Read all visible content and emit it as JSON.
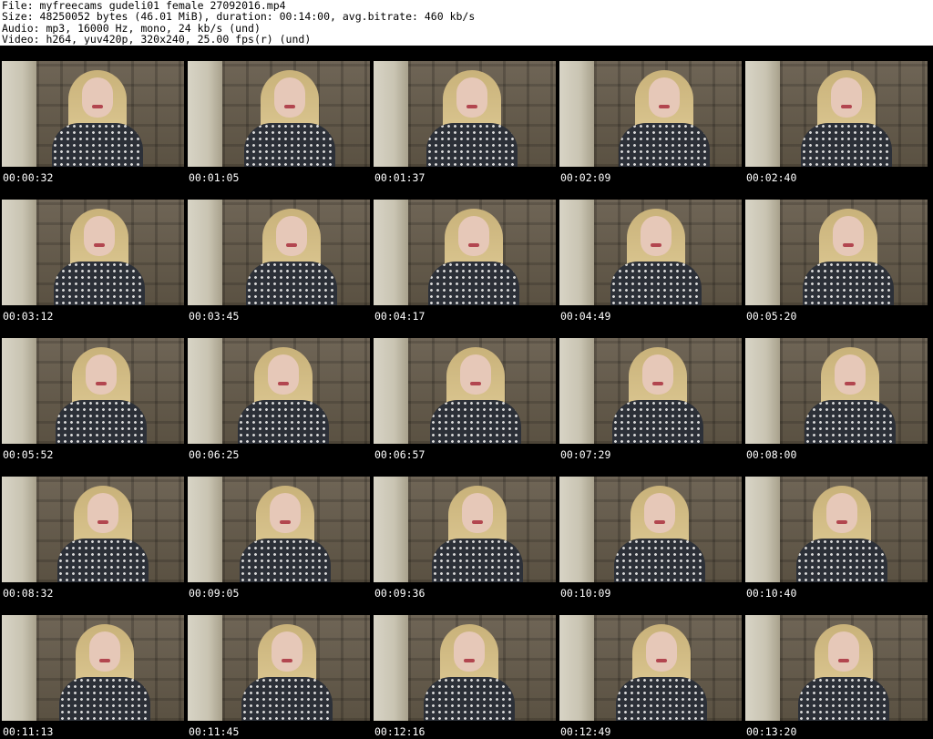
{
  "header": {
    "file_line": "File: myfreecams_gudeli01_female_27092016.mp4",
    "size_line": "Size: 48250052 bytes (46.01 MiB), duration: 00:14:00, avg.bitrate: 460 kb/s",
    "audio_line": "Audio: mp3, 16000 Hz, mono, 24 kb/s (und)",
    "video_line": "Video: h264, yuv420p, 320x240, 25.00 fps(r) (und)"
  },
  "thumbnails": [
    {
      "time": "00:00:32"
    },
    {
      "time": "00:01:05"
    },
    {
      "time": "00:01:37"
    },
    {
      "time": "00:02:09"
    },
    {
      "time": "00:02:40"
    },
    {
      "time": "00:03:12"
    },
    {
      "time": "00:03:45"
    },
    {
      "time": "00:04:17"
    },
    {
      "time": "00:04:49"
    },
    {
      "time": "00:05:20"
    },
    {
      "time": "00:05:52"
    },
    {
      "time": "00:06:25"
    },
    {
      "time": "00:06:57"
    },
    {
      "time": "00:07:29"
    },
    {
      "time": "00:08:00"
    },
    {
      "time": "00:08:32"
    },
    {
      "time": "00:09:05"
    },
    {
      "time": "00:09:36"
    },
    {
      "time": "00:10:09"
    },
    {
      "time": "00:10:40"
    },
    {
      "time": "00:11:13"
    },
    {
      "time": "00:11:45"
    },
    {
      "time": "00:12:16"
    },
    {
      "time": "00:12:49"
    },
    {
      "time": "00:13:20"
    }
  ]
}
